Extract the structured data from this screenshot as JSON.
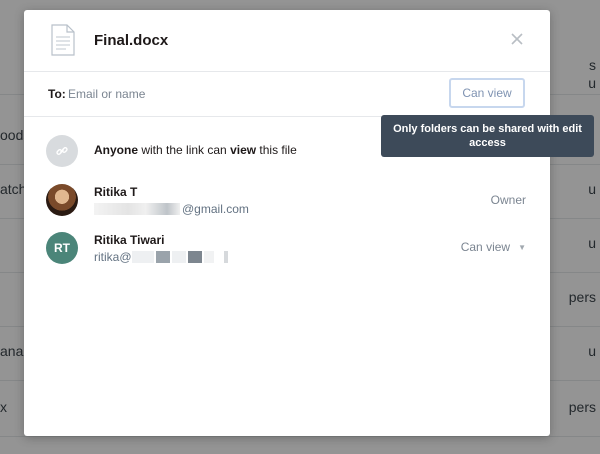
{
  "background": {
    "rows": [
      {
        "left": "",
        "right": "s"
      },
      {
        "left": "",
        "right": "u"
      },
      {
        "left": "oods",
        "right": ""
      },
      {
        "left": "atch",
        "right": "u"
      },
      {
        "left": "",
        "right": "u"
      },
      {
        "left": "",
        "right": "pers"
      },
      {
        "left": "ana",
        "right": "u"
      },
      {
        "left": "x",
        "right": "pers"
      }
    ]
  },
  "dialog": {
    "file_icon": "document-icon",
    "title": "Final.docx",
    "close_icon": "close-icon"
  },
  "share_to": {
    "label": "To:",
    "placeholder": "Email or name",
    "value": "",
    "permission": "Can view"
  },
  "tooltip": {
    "text": "Only folders can be shared with edit access"
  },
  "link_row": {
    "icon": "link-icon",
    "prefix": "Anyone",
    "middle": " with the link can ",
    "permission": "view",
    "suffix": " this file"
  },
  "members": [
    {
      "name": "Ritika T",
      "email_visible": "@gmail.com",
      "role": "Owner",
      "avatar": "photo"
    },
    {
      "name": "Ritika Tiwari",
      "email_visible": "ritika@",
      "role": "Can view",
      "initials": "RT",
      "avatar_color": "#4b8579"
    }
  ],
  "colors": {
    "accent_light": "#c7d7ee",
    "tooltip_bg": "#3d4a59",
    "text_primary": "#1e1919",
    "text_secondary": "#637282"
  }
}
